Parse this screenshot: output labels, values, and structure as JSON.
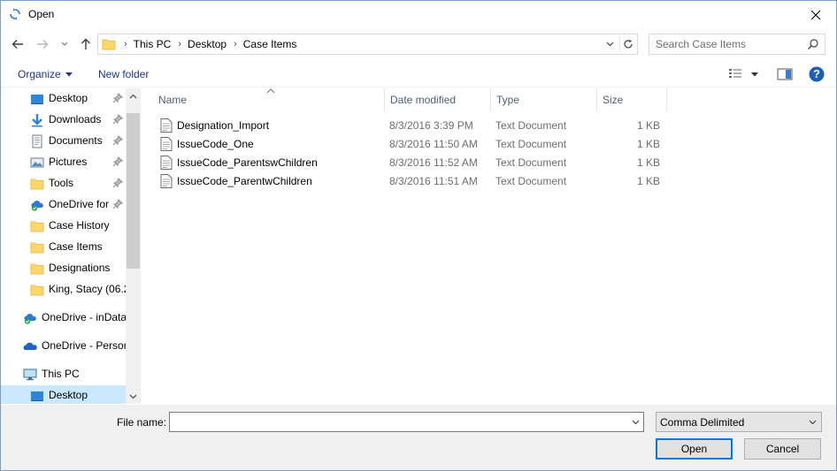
{
  "window": {
    "title": "Open",
    "close_glyph": "✕"
  },
  "nav": {
    "back_icon": "arrow-left",
    "forward_icon": "arrow-right",
    "recent_icon": "chevron-down",
    "up_icon": "arrow-up",
    "breadcrumbs": [
      "This PC",
      "Desktop",
      "Case Items"
    ],
    "crumb_separator": "›",
    "search_placeholder": "Search Case Items"
  },
  "toolbar": {
    "organize_label": "Organize",
    "new_folder_label": "New folder",
    "help_label": "?"
  },
  "sidebar": {
    "items": [
      {
        "label": "Desktop",
        "icon": "desktop-icon",
        "pinned": true
      },
      {
        "label": "Downloads",
        "icon": "download-icon",
        "pinned": true
      },
      {
        "label": "Documents",
        "icon": "documents-icon",
        "pinned": true
      },
      {
        "label": "Pictures",
        "icon": "pictures-icon",
        "pinned": true
      },
      {
        "label": "Tools",
        "icon": "folder-icon",
        "pinned": true
      },
      {
        "label": "OneDrive for",
        "icon": "onedrive-sync-icon",
        "pinned": true
      },
      {
        "label": "Case History",
        "icon": "folder-icon",
        "pinned": false
      },
      {
        "label": "Case Items",
        "icon": "folder-icon",
        "pinned": false
      },
      {
        "label": "Designations",
        "icon": "folder-icon",
        "pinned": false
      },
      {
        "label": "King, Stacy (06.2",
        "icon": "folder-icon",
        "pinned": false
      },
      {
        "label": "OneDrive - inData",
        "icon": "onedrive-sync-icon",
        "pinned": false
      },
      {
        "label": "OneDrive - Person",
        "icon": "onedrive-icon",
        "pinned": false
      },
      {
        "label": "This PC",
        "icon": "computer-icon",
        "pinned": false
      },
      {
        "label": "Desktop",
        "icon": "desktop-icon",
        "pinned": false
      }
    ]
  },
  "filelist": {
    "columns": [
      "Name",
      "Date modified",
      "Type",
      "Size"
    ],
    "rows": [
      {
        "name": "Designation_Import",
        "date": "8/3/2016 3:39 PM",
        "type": "Text Document",
        "size": "1 KB"
      },
      {
        "name": "IssueCode_One",
        "date": "8/3/2016 11:50 AM",
        "type": "Text Document",
        "size": "1 KB"
      },
      {
        "name": "IssueCode_ParentswChildren",
        "date": "8/3/2016 11:52 AM",
        "type": "Text Document",
        "size": "1 KB"
      },
      {
        "name": "IssueCode_ParentwChildren",
        "date": "8/3/2016 11:51 AM",
        "type": "Text Document",
        "size": "1 KB"
      }
    ]
  },
  "footer": {
    "filename_label": "File name:",
    "filename_value": "",
    "filetype_value": "Comma Delimited",
    "open_label": "Open",
    "cancel_label": "Cancel"
  },
  "colors": {
    "folder": "#ffd86b",
    "selection": "#cce8ff",
    "accent": "#0078d7",
    "link": "#1e3287"
  }
}
